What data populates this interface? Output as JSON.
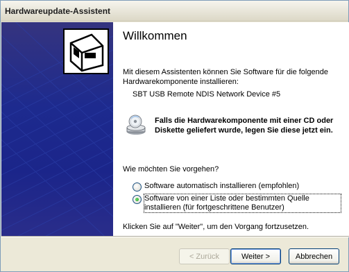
{
  "window": {
    "title": "Hardwareupdate-Assistent"
  },
  "main": {
    "heading": "Willkommen",
    "intro": "Mit diesem Assistenten können Sie Software für die folgende Hardwarekomponente installieren:",
    "device": "SBT USB Remote NDIS Network Device #5",
    "cd_notice": "Falls die Hardwarekomponente mit einer CD oder Diskette geliefert wurde, legen Sie diese jetzt ein.",
    "question": "Wie möchten Sie vorgehen?",
    "options": [
      {
        "label": "Software automatisch installieren (empfohlen)",
        "checked": false
      },
      {
        "label": "Software von einer Liste oder bestimmten Quelle installieren (für fortgeschrittene Benutzer)",
        "checked": true
      }
    ],
    "continue_hint": "Klicken Sie auf \"Weiter\", um den Vorgang fortzusetzen."
  },
  "buttons": {
    "back": "< Zurück",
    "next": "Weiter >",
    "cancel": "Abbrechen"
  },
  "icons": {
    "sidebar": "hardware-wizard-icon",
    "cd": "cd-drive-icon"
  }
}
